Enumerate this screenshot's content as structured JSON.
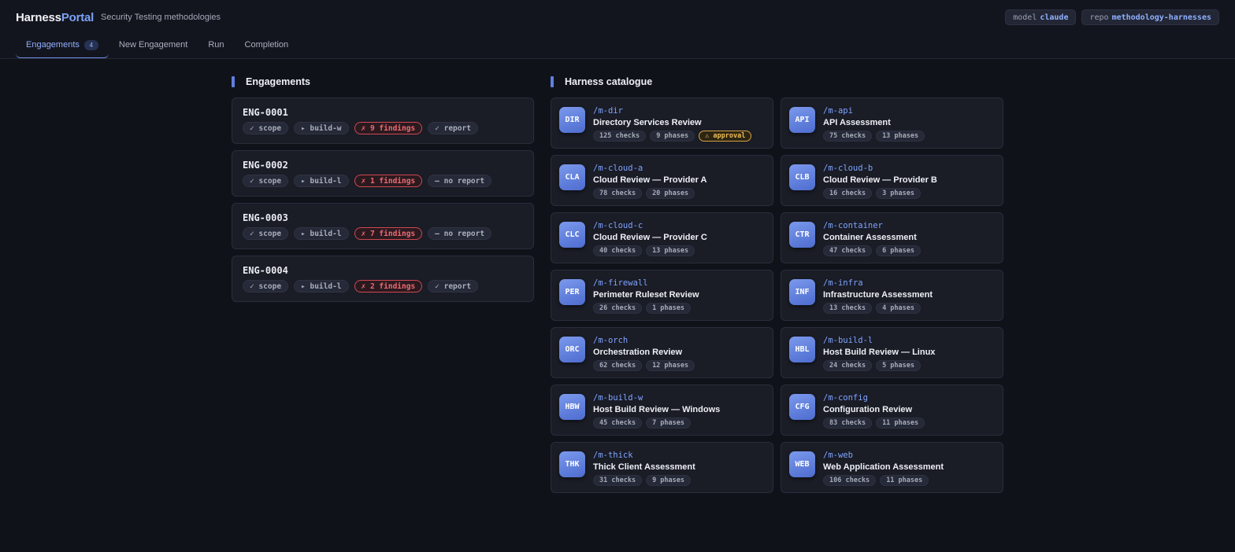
{
  "header": {
    "brand_part1": "Harness",
    "brand_part2": "Portal",
    "subtitle": "Security Testing methodologies",
    "chips": [
      {
        "key": "model",
        "value": "claude"
      },
      {
        "key": "repo",
        "value": "methodology-harnesses"
      }
    ]
  },
  "tabs": [
    {
      "label": "Engagements",
      "count": "4"
    },
    {
      "label": "New Engagement"
    },
    {
      "label": "Run"
    },
    {
      "label": "Completion"
    }
  ],
  "engagements": {
    "title": "Engagements",
    "items": [
      {
        "id": "ENG-0001",
        "tags": [
          "✓ scope",
          "▸ build-w",
          "✗ 9 findings",
          "✓ report"
        ]
      },
      {
        "id": "ENG-0002",
        "tags": [
          "✓ scope",
          "▸ build-l",
          "✗ 1 findings",
          "— no report"
        ]
      },
      {
        "id": "ENG-0003",
        "tags": [
          "✓ scope",
          "▸ build-l",
          "✗ 7 findings",
          "— no report"
        ]
      },
      {
        "id": "ENG-0004",
        "tags": [
          "✓ scope",
          "▸ build-l",
          "✗ 2 findings",
          "✓ report"
        ]
      }
    ]
  },
  "catalogue": {
    "title": "Harness catalogue",
    "items": [
      {
        "abbr": "DIR",
        "path": "/m-dir",
        "name": "Directory Services Review",
        "checks": "125 checks",
        "phases": "9 phases",
        "extra": "⚠ approval"
      },
      {
        "abbr": "API",
        "path": "/m-api",
        "name": "API Assessment",
        "checks": "75 checks",
        "phases": "13 phases"
      },
      {
        "abbr": "CLA",
        "path": "/m-cloud-a",
        "name": "Cloud Review — Provider A",
        "checks": "78 checks",
        "phases": "20 phases"
      },
      {
        "abbr": "CLB",
        "path": "/m-cloud-b",
        "name": "Cloud Review — Provider B",
        "checks": "16 checks",
        "phases": "3 phases"
      },
      {
        "abbr": "CLC",
        "path": "/m-cloud-c",
        "name": "Cloud Review — Provider C",
        "checks": "40 checks",
        "phases": "13 phases"
      },
      {
        "abbr": "CTR",
        "path": "/m-container",
        "name": "Container Assessment",
        "checks": "47 checks",
        "phases": "6 phases"
      },
      {
        "abbr": "PER",
        "path": "/m-firewall",
        "name": "Perimeter Ruleset Review",
        "checks": "26 checks",
        "phases": "1 phases"
      },
      {
        "abbr": "INF",
        "path": "/m-infra",
        "name": "Infrastructure Assessment",
        "checks": "13 checks",
        "phases": "4 phases"
      },
      {
        "abbr": "ORC",
        "path": "/m-orch",
        "name": "Orchestration Review",
        "checks": "62 checks",
        "phases": "12 phases"
      },
      {
        "abbr": "HBL",
        "path": "/m-build-l",
        "name": "Host Build Review — Linux",
        "checks": "24 checks",
        "phases": "5 phases"
      },
      {
        "abbr": "HBW",
        "path": "/m-build-w",
        "name": "Host Build Review — Windows",
        "checks": "45 checks",
        "phases": "7 phases"
      },
      {
        "abbr": "CFG",
        "path": "/m-config",
        "name": "Configuration Review",
        "checks": "83 checks",
        "phases": "11 phases"
      },
      {
        "abbr": "THK",
        "path": "/m-thick",
        "name": "Thick Client Assessment",
        "checks": "31 checks",
        "phases": "9 phases"
      },
      {
        "abbr": "WEB",
        "path": "/m-web",
        "name": "Web Application Assessment",
        "checks": "106 checks",
        "phases": "11 phases"
      }
    ]
  },
  "colors": {
    "accent": "#7aa2f7",
    "danger": "#ef6a70",
    "warning": "#f0bf55",
    "background": "#10121a"
  }
}
